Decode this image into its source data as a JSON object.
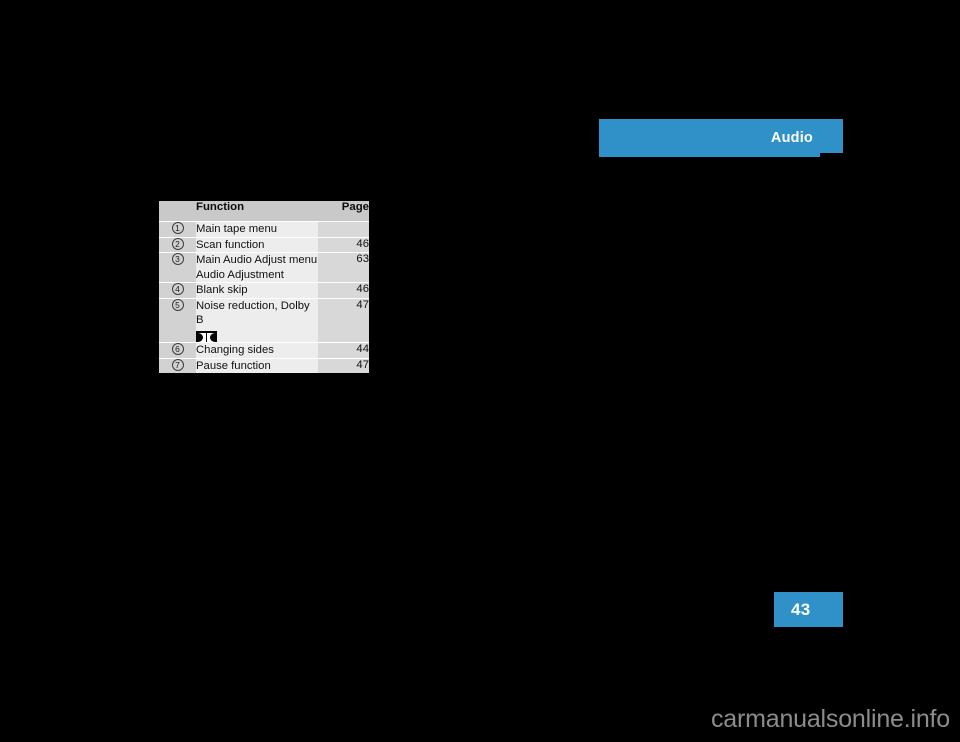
{
  "section_header": {
    "title": "Audio",
    "accent_color": "#3091c8",
    "text_color": "#ffffff"
  },
  "page_badge": {
    "number": "43",
    "accent_color": "#3091c8",
    "text_color": "#ffffff"
  },
  "table": {
    "columns": [
      "",
      "Function",
      "Page"
    ],
    "rows": [
      {
        "marker": "1",
        "function_lines": [
          "Main tape menu"
        ],
        "page": ""
      },
      {
        "marker": "2",
        "function_lines": [
          "Scan function"
        ],
        "page": "46"
      },
      {
        "marker": "3",
        "function_lines": [
          "Main Audio Adjust menu",
          "Audio Adjustment"
        ],
        "page": "63"
      },
      {
        "marker": "4",
        "function_lines": [
          "Blank skip"
        ],
        "page": "46"
      },
      {
        "marker": "5",
        "function_lines": [
          "Noise reduction, Dolby B"
        ],
        "page": "47",
        "symbol": "dolby-logo"
      },
      {
        "marker": "6",
        "function_lines": [
          "Changing sides"
        ],
        "page": "44"
      },
      {
        "marker": "7",
        "function_lines": [
          "Pause function"
        ],
        "page": "47"
      }
    ]
  },
  "watermark": {
    "text": "carmanualsonline.info",
    "color": "#8c8c8c"
  }
}
